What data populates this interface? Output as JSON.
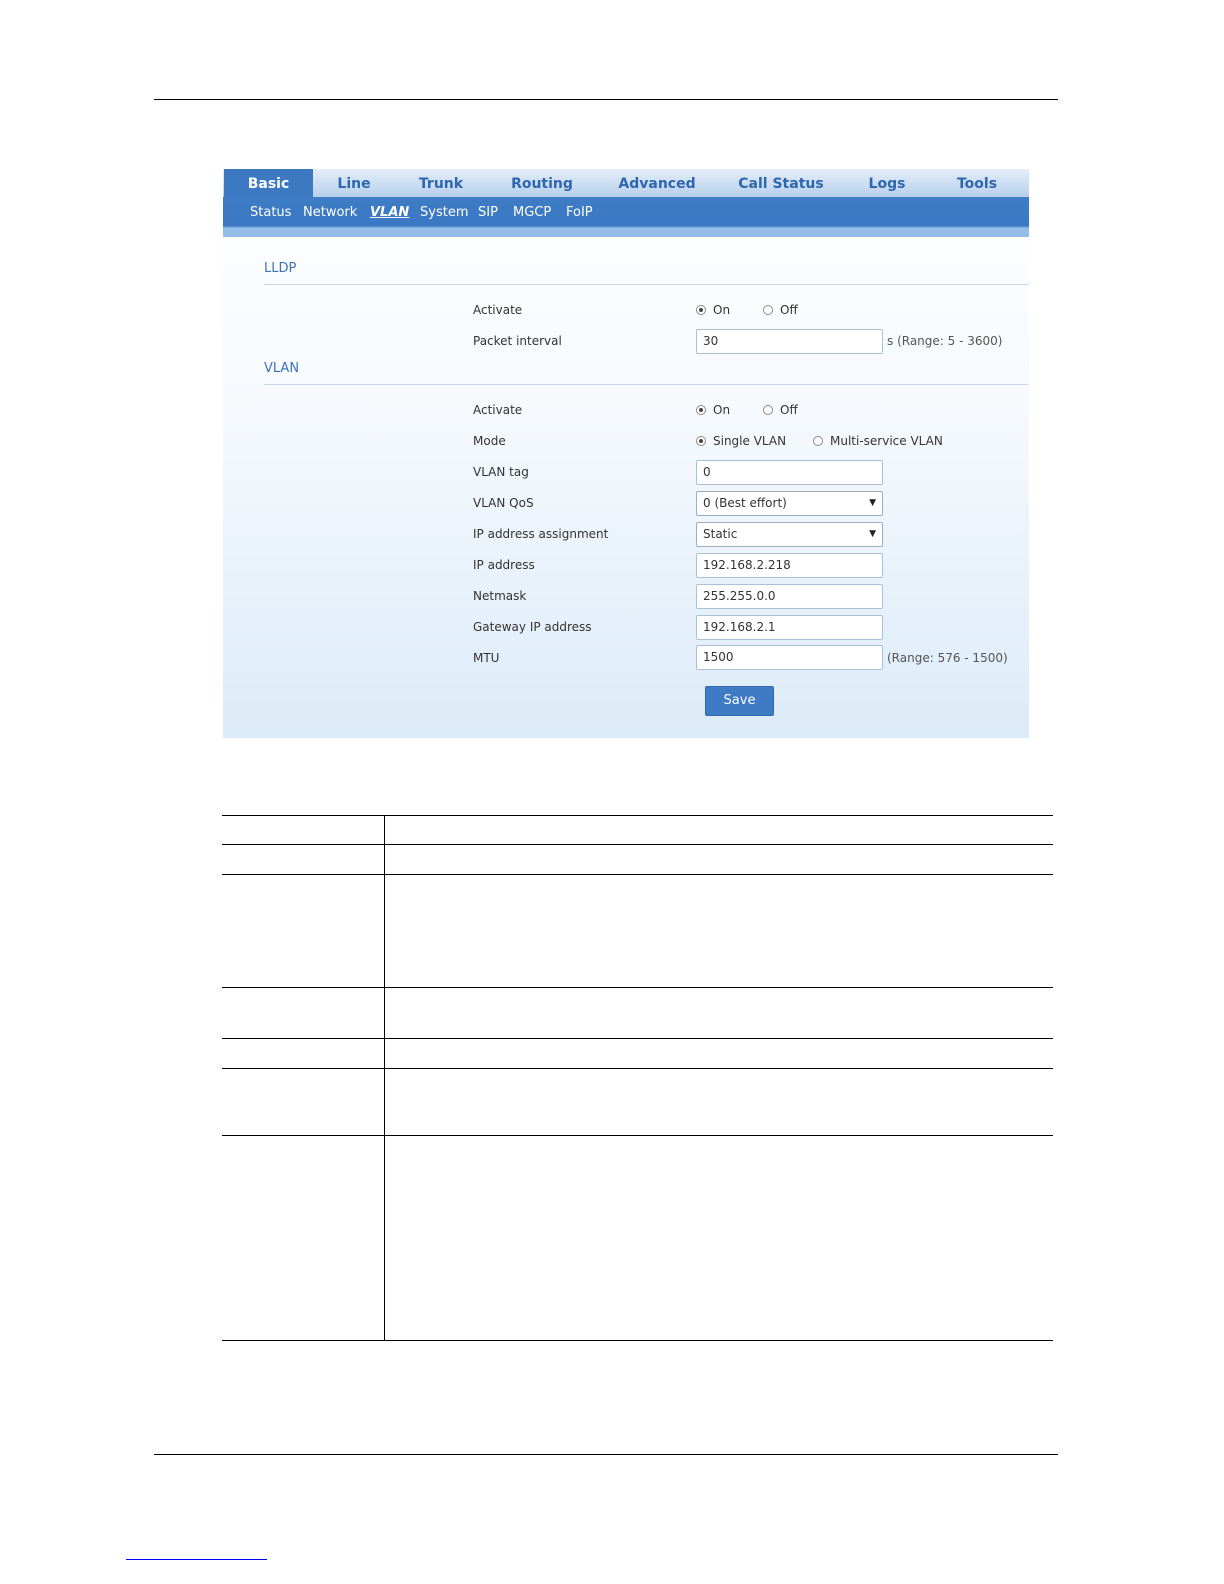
{
  "nav": {
    "tabs": [
      {
        "label": "Basic"
      },
      {
        "label": "Line"
      },
      {
        "label": "Trunk"
      },
      {
        "label": "Routing"
      },
      {
        "label": "Advanced"
      },
      {
        "label": "Call Status"
      },
      {
        "label": "Logs"
      },
      {
        "label": "Tools"
      }
    ],
    "active_tab": "Basic",
    "subtabs": [
      {
        "label": "Status"
      },
      {
        "label": "Network"
      },
      {
        "label": "VLAN"
      },
      {
        "label": "System"
      },
      {
        "label": "SIP"
      },
      {
        "label": "MGCP"
      },
      {
        "label": "FoIP"
      }
    ],
    "active_subtab": "VLAN"
  },
  "lldp": {
    "title": "LLDP",
    "activate_label": "Activate",
    "on_label": "On",
    "off_label": "Off",
    "activate_value": "On",
    "interval_label": "Packet interval",
    "interval_value": "30",
    "interval_hint": "s (Range: 5 - 3600)"
  },
  "vlan": {
    "title": "VLAN",
    "activate_label": "Activate",
    "on_label": "On",
    "off_label": "Off",
    "activate_value": "On",
    "mode_label": "Mode",
    "mode_single": "Single VLAN",
    "mode_multi": "Multi-service VLAN",
    "mode_value": "Single VLAN",
    "tag_label": "VLAN tag",
    "tag_value": "0",
    "qos_label": "VLAN QoS",
    "qos_value": "0 (Best effort)",
    "ipassign_label": "IP address assignment",
    "ipassign_value": "Static",
    "ip_label": "IP address",
    "ip_value": "192.168.2.218",
    "netmask_label": "Netmask",
    "netmask_value": "255.255.0.0",
    "gateway_label": "Gateway IP address",
    "gateway_value": "192.168.2.1",
    "mtu_label": "MTU",
    "mtu_value": "1500",
    "mtu_hint": "(Range: 576 - 1500)",
    "save_label": "Save"
  },
  "colors": {
    "tab_active": "#3d78c2",
    "tab_text": "#2f66b0",
    "subnav_bg": "#3a78c3",
    "section_title": "#3e72b8",
    "save_button": "#3e7bc4"
  }
}
